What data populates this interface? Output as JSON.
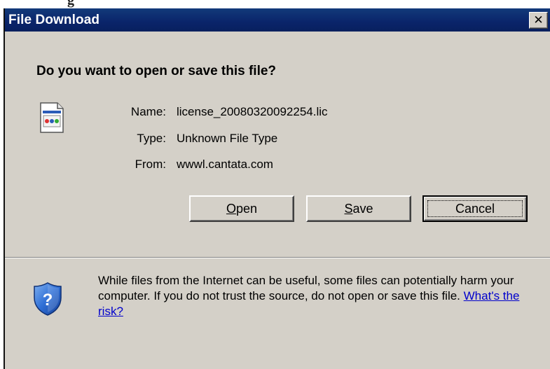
{
  "background_text": "g",
  "dialog": {
    "title": "File Download",
    "close_glyph": "✕",
    "question": "Do you want to open or save this file?",
    "file_info": {
      "name_label": "Name:",
      "name_value": "license_20080320092254.lic",
      "type_label": "Type:",
      "type_value": "Unknown File Type",
      "from_label": "From:",
      "from_value": "wwwl.cantata.com"
    },
    "buttons": {
      "open": "Open",
      "save": "Save",
      "cancel": "Cancel"
    },
    "warning": {
      "text": "While files from the Internet can be useful, some files can potentially harm your computer. If you do not trust the source, do not open or save this file. ",
      "link": "What's the risk?"
    }
  },
  "icons": {
    "file": "file-icon",
    "shield": "shield-question-icon"
  },
  "colors": {
    "titlebar": "#0a246a",
    "dialog_bg": "#d4d0c8",
    "link": "#0000cc"
  }
}
